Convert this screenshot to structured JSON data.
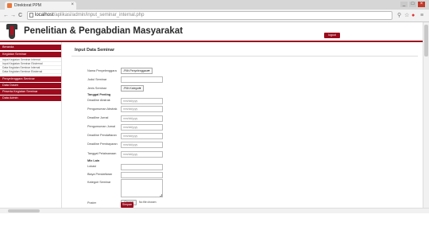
{
  "browser": {
    "tab_title": "Direktorat PPM",
    "tab_close": "×",
    "url_host": "localhost",
    "url_path": "/aplikasi/admin/input_seminar_internal.php",
    "win_minimize": "_",
    "win_maximize": "□",
    "win_close": "×",
    "nav_back": "←",
    "nav_forward": "→",
    "nav_reload": "C"
  },
  "header": {
    "title": "Penelitian & Pengabdian Masyarakat",
    "logout_label": "logout"
  },
  "sidebar": {
    "items": [
      {
        "label": "Beranda",
        "type": "header"
      },
      {
        "label": "Kegiatan Seminar",
        "type": "header"
      },
      {
        "label": "Input Kegiatan Seminar Internal",
        "type": "sub"
      },
      {
        "label": "Input Kegiatan Seminar Eksternal",
        "type": "sub"
      },
      {
        "label": "Data Kegiatan Seminar Internal",
        "type": "sub"
      },
      {
        "label": "Data Kegiatan Seminar Eksternal",
        "type": "sub"
      },
      {
        "label": "Penyelenggara Seminar",
        "type": "header"
      },
      {
        "label": "Data Dosen",
        "type": "header"
      },
      {
        "label": "Peserta Kegiatan Seminar",
        "type": "header"
      },
      {
        "label": "Data Admin",
        "type": "header"
      }
    ]
  },
  "form": {
    "title": "Input Data Seminar",
    "nama_penyelenggara_label": "Nama Penyelenggara",
    "nama_penyelenggara_value": "-Pilih Penyelenggara-",
    "judul_seminar_label": "Judul Seminar",
    "jenis_seminar_label": "Jenis Seminar",
    "jenis_seminar_value": "-Pilih Kategori-",
    "tanggal_section": "Tanggal Penting",
    "date_placeholder": "mm/dd/yyyy",
    "deadline_abstrak_label": "Deadline Abstrak",
    "pengumuman_abstrak_label": "Pengumuman Abstrak",
    "deadline_jurnal_label": "Deadline Jurnal",
    "pengumuman_jurnal_label": "Pengumuman Jurnal",
    "deadline_pendaftaran_label": "Deadline Pendaftaran",
    "deadline_pembayaran_label": "Deadline Pembayaran",
    "tanggal_pelaksanaan_label": "Tanggal Pelaksanaan",
    "mix_section": "Mix Lain",
    "lokasi_label": "Lokasi",
    "biaya_label": "Biaya Pendaftaran",
    "kategori_label": "Kategori Seminar",
    "poster_label": "Poster",
    "file_button": "Choose File",
    "file_status": "No file chosen",
    "submit_label": "Simpan",
    "dropdown_arrow": "▼"
  }
}
